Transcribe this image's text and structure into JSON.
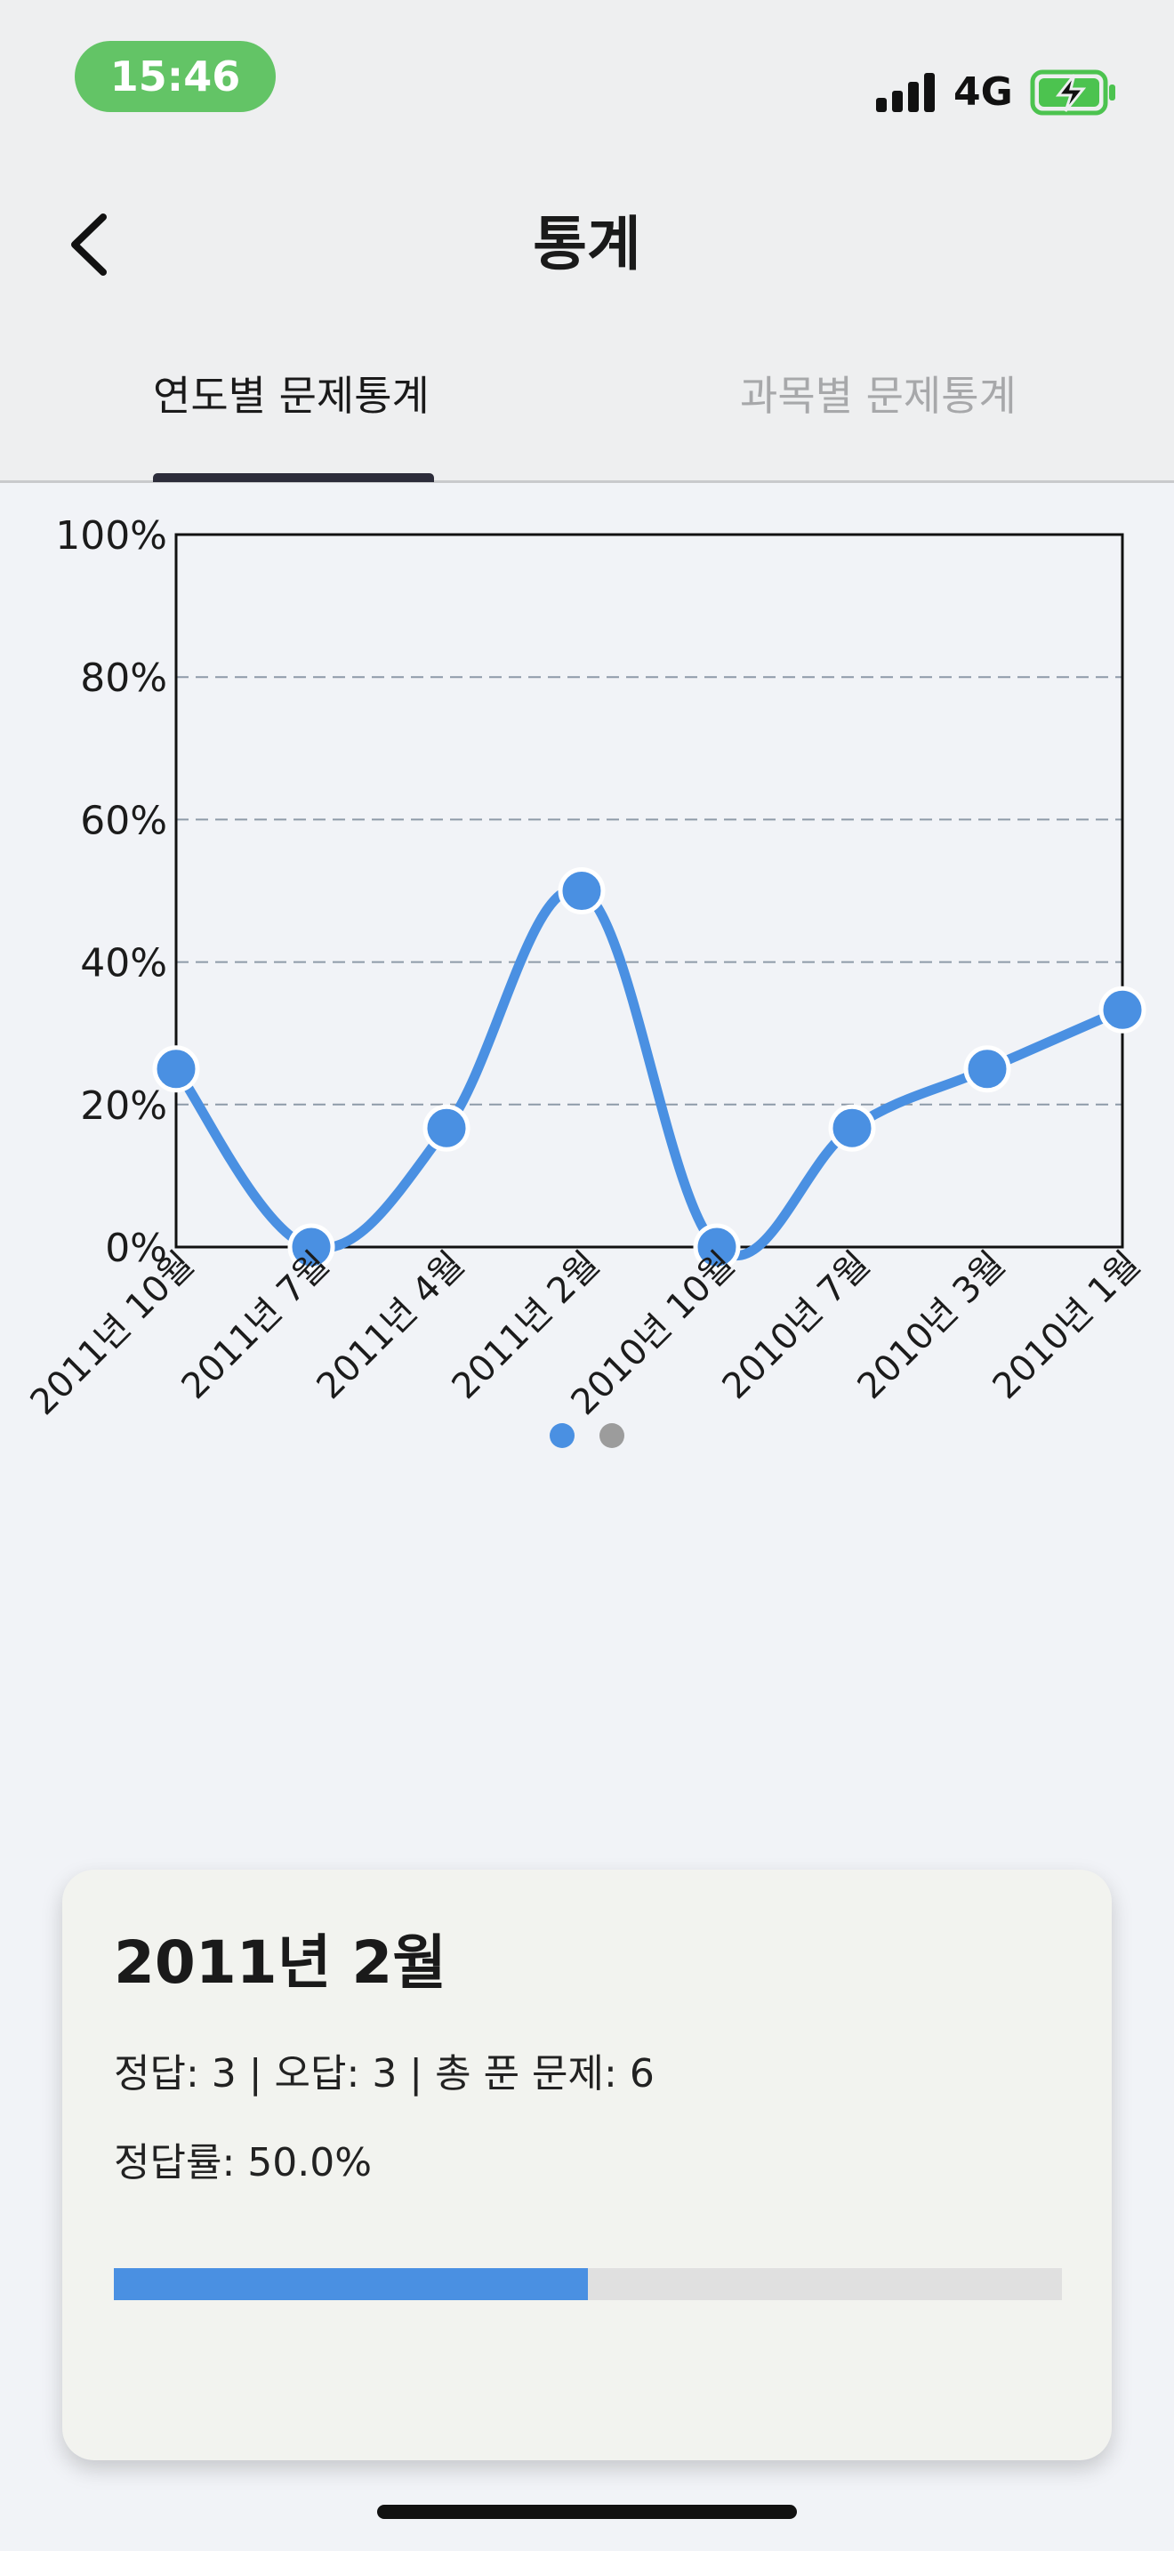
{
  "status_bar": {
    "time": "15:46",
    "network": "4G",
    "time_pill_color": "#63c466",
    "battery_icon": "battery-charging-icon",
    "signal_icon": "cellular-signal-icon"
  },
  "nav": {
    "back_icon": "chevron-left-icon",
    "title": "통계"
  },
  "tabs": [
    {
      "label": "연도별 문제통계",
      "selected": true
    },
    {
      "label": "과목별 문제통계",
      "selected": false
    }
  ],
  "chart_data": {
    "type": "line",
    "categories": [
      "2011년 10월",
      "2011년 7월",
      "2011년 4월",
      "2011년 2월",
      "2010년 10월",
      "2010년 7월",
      "2010년 3월",
      "2010년 1월"
    ],
    "series": [
      {
        "values": [
          25,
          0,
          16.7,
          50,
          0,
          16.7,
          25,
          33.3
        ]
      }
    ],
    "y_ticks": [
      "0%",
      "20%",
      "40%",
      "60%",
      "80%",
      "100%"
    ],
    "ylim": [
      0,
      100
    ],
    "grid": "horizontal dashed",
    "line_color": "#4a90e2",
    "smooth": true
  },
  "pager": {
    "pages": 2,
    "active_index": 0
  },
  "detail": {
    "title": "2011년 2월",
    "counts": "정답: 3 | 오답: 3 | 총 푼 문제: 6",
    "rate": "정답률: 50.0%",
    "progress": 0.5,
    "progress_color": "#4a90e2"
  }
}
